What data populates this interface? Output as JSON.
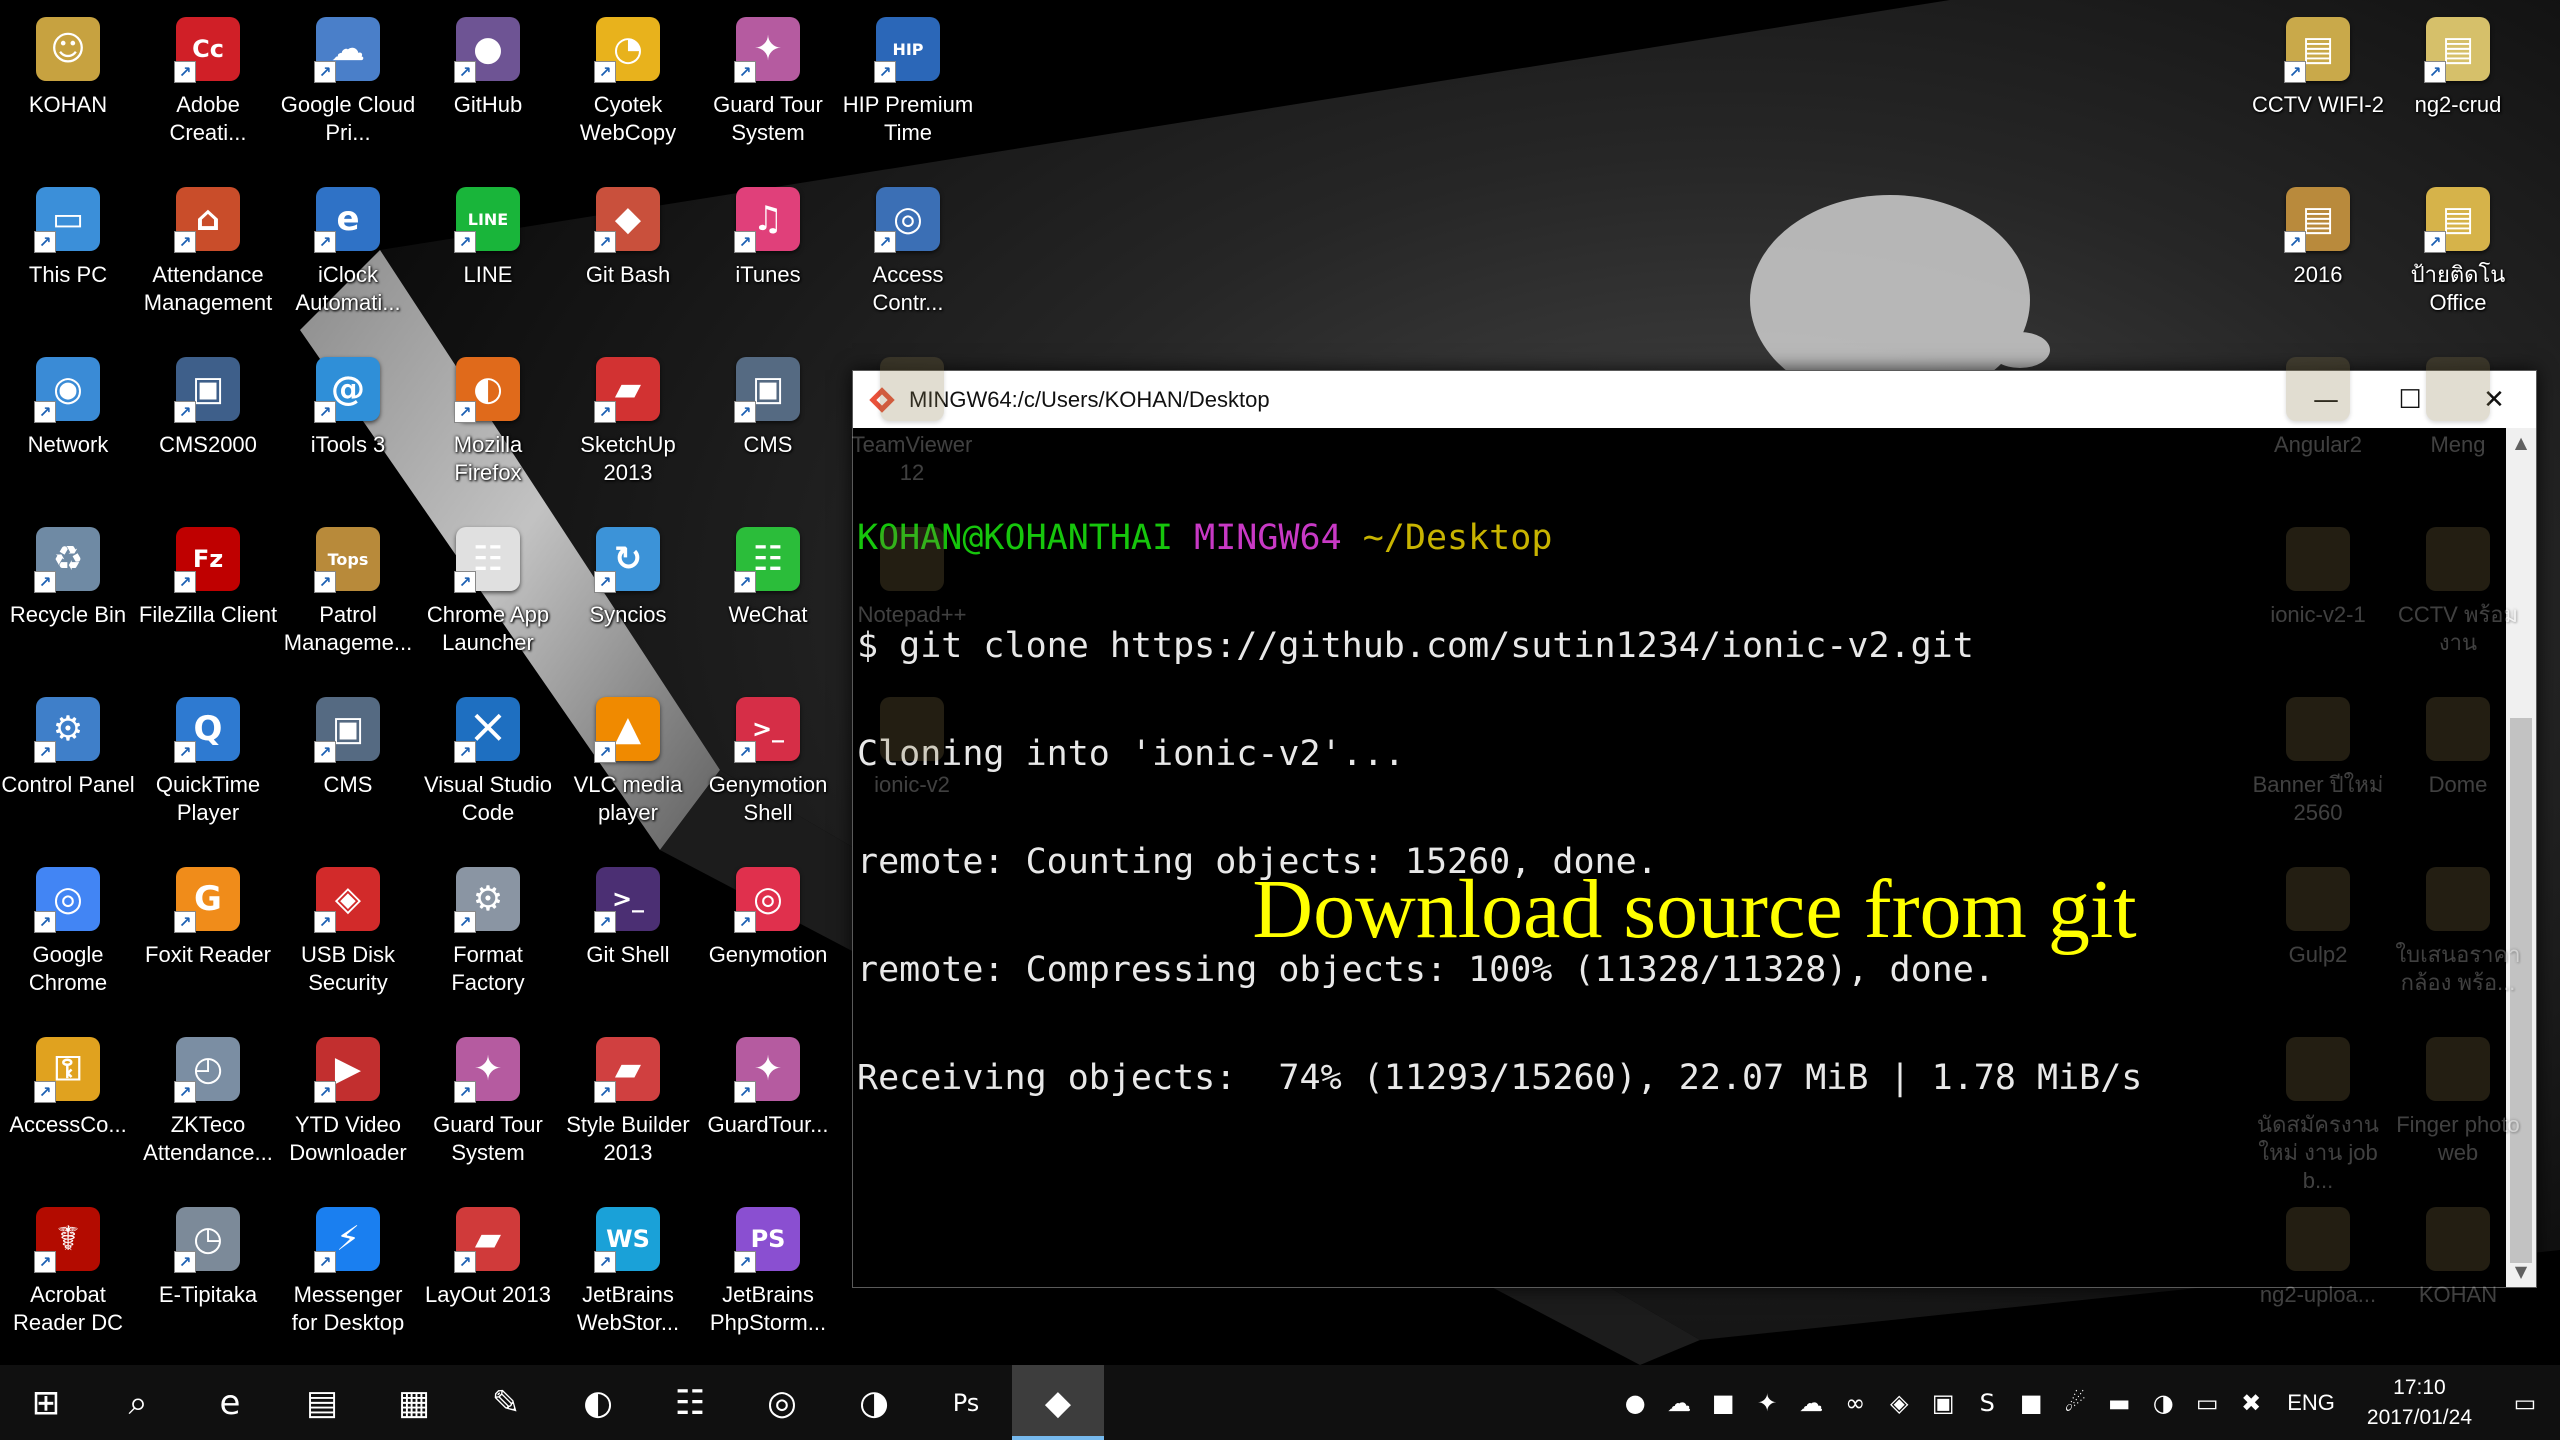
{
  "desktop": {
    "icons": [
      {
        "label": "KOHAN",
        "icon": "folder-user-icon",
        "color": "#c7a240",
        "glyph": "☺"
      },
      {
        "label": "Adobe Creati...",
        "icon": "adobe-cc-icon",
        "color": "#d01f27",
        "glyph": "Cc"
      },
      {
        "label": "Google Cloud Pri...",
        "icon": "printer-cloud-icon",
        "color": "#4a7fc9",
        "glyph": "☁"
      },
      {
        "label": "GitHub",
        "icon": "github-icon",
        "color": "#6e5494",
        "glyph": "●"
      },
      {
        "label": "Cyotek WebCopy",
        "icon": "webcopy-icon",
        "color": "#e8b21c",
        "glyph": "◔"
      },
      {
        "label": "Guard Tour System",
        "icon": "guard-tour-icon",
        "color": "#b55ba0",
        "glyph": "✦"
      },
      {
        "label": "HIP Premium Time",
        "icon": "hip-time-icon",
        "color": "#2b67b8",
        "glyph": "HIP"
      },
      {
        "label": "This PC",
        "icon": "computer-icon",
        "color": "#3b8fd9",
        "glyph": "▭"
      },
      {
        "label": "Attendance Management",
        "icon": "attendance-icon",
        "color": "#c94d2a",
        "glyph": "⌂"
      },
      {
        "label": "iClock Automati...",
        "icon": "iclock-icon",
        "color": "#2f72c6",
        "glyph": "e"
      },
      {
        "label": "LINE",
        "icon": "line-icon",
        "color": "#19b53a",
        "glyph": "LINE"
      },
      {
        "label": "Git Bash",
        "icon": "git-bash-icon",
        "color": "#c9503c",
        "glyph": "◆"
      },
      {
        "label": "iTunes",
        "icon": "itunes-icon",
        "color": "#e0407a",
        "glyph": "♫"
      },
      {
        "label": "Access Contr...",
        "icon": "access-control-icon",
        "color": "#3b6fb5",
        "glyph": "◎"
      },
      {
        "label": "Network",
        "icon": "network-icon",
        "color": "#3a8bd6",
        "glyph": "◉"
      },
      {
        "label": "CMS2000",
        "icon": "cms2000-icon",
        "color": "#3e5f8a",
        "glyph": "▣"
      },
      {
        "label": "iTools 3",
        "icon": "itools-icon",
        "color": "#2f8fd8",
        "glyph": "@"
      },
      {
        "label": "Mozilla Firefox",
        "icon": "firefox-icon",
        "color": "#e06a1b",
        "glyph": "◐"
      },
      {
        "label": "SketchUp 2013",
        "icon": "sketchup-icon",
        "color": "#d23232",
        "glyph": "▰"
      },
      {
        "label": "CMS",
        "icon": "cms-icon",
        "color": "#556a82",
        "glyph": "▣"
      },
      {
        "label": "Recycle Bin",
        "icon": "recycle-bin-icon",
        "color": "#6f8aa4",
        "glyph": "♻"
      },
      {
        "label": "FileZilla Client",
        "icon": "filezilla-icon",
        "color": "#bf0000",
        "glyph": "Fz"
      },
      {
        "label": "Patrol Manageme...",
        "icon": "patrol-icon",
        "color": "#b88a3a",
        "glyph": "Tops"
      },
      {
        "label": "Chrome App Launcher",
        "icon": "app-launcher-icon",
        "color": "#e0e0e0",
        "glyph": "☷"
      },
      {
        "label": "Syncios",
        "icon": "syncios-icon",
        "color": "#3c93d8",
        "glyph": "↻"
      },
      {
        "label": "WeChat",
        "icon": "wechat-icon",
        "color": "#2bbd3a",
        "glyph": "☷"
      },
      {
        "label": "Control Panel",
        "icon": "control-panel-icon",
        "color": "#3f7fc9",
        "glyph": "⚙"
      },
      {
        "label": "QuickTime Player",
        "icon": "quicktime-icon",
        "color": "#2e7ad1",
        "glyph": "Q"
      },
      {
        "label": "CMS",
        "icon": "cms-icon",
        "color": "#556a82",
        "glyph": "▣"
      },
      {
        "label": "Visual Studio Code",
        "icon": "vscode-icon",
        "color": "#1e6fc1",
        "glyph": "⨉"
      },
      {
        "label": "VLC media player",
        "icon": "vlc-icon",
        "color": "#f08a00",
        "glyph": "▲"
      },
      {
        "label": "Genymotion Shell",
        "icon": "genymotion-shell-icon",
        "color": "#d62e47",
        "glyph": ">_"
      },
      {
        "label": "Google Chrome",
        "icon": "chrome-icon",
        "color": "#4285f4",
        "glyph": "◎"
      },
      {
        "label": "Foxit Reader",
        "icon": "foxit-icon",
        "color": "#f08c1a",
        "glyph": "G"
      },
      {
        "label": "USB Disk Security",
        "icon": "usb-security-icon",
        "color": "#d22a2a",
        "glyph": "◈"
      },
      {
        "label": "Format Factory",
        "icon": "format-factory-icon",
        "color": "#8a95a3",
        "glyph": "⚙"
      },
      {
        "label": "Git Shell",
        "icon": "git-shell-icon",
        "color": "#4b2f73",
        "glyph": ">_"
      },
      {
        "label": "Genymotion",
        "icon": "genymotion-icon",
        "color": "#e0304d",
        "glyph": "◎"
      },
      {
        "label": "AccessCo...",
        "icon": "access-key-icon",
        "color": "#e0a21f",
        "glyph": "⚿"
      },
      {
        "label": "ZKTeco Attendance...",
        "icon": "zkteco-icon",
        "color": "#7b8ea3",
        "glyph": "◴"
      },
      {
        "label": "YTD Video Downloader",
        "icon": "ytd-icon",
        "color": "#c22f2f",
        "glyph": "▶"
      },
      {
        "label": "Guard Tour System",
        "icon": "guard-tour-icon",
        "color": "#b55ba0",
        "glyph": "✦"
      },
      {
        "label": "Style Builder 2013",
        "icon": "style-builder-icon",
        "color": "#d04040",
        "glyph": "▰"
      },
      {
        "label": "GuardTour...",
        "icon": "guard-tour-icon",
        "color": "#b55ba0",
        "glyph": "✦"
      },
      {
        "label": "Acrobat Reader DC",
        "icon": "acrobat-icon",
        "color": "#b30b00",
        "glyph": "☤"
      },
      {
        "label": "E-Tipitaka",
        "icon": "etipitaka-icon",
        "color": "#7c8a99",
        "glyph": "◷"
      },
      {
        "label": "Messenger for Desktop",
        "icon": "messenger-icon",
        "color": "#1a7ff0",
        "glyph": "⚡"
      },
      {
        "label": "LayOut 2013",
        "icon": "layout-icon",
        "color": "#d03a3a",
        "glyph": "▰"
      },
      {
        "label": "JetBrains WebStor...",
        "icon": "webstorm-icon",
        "color": "#1aa1d8",
        "glyph": "WS"
      },
      {
        "label": "JetBrains PhpStorm...",
        "icon": "phpstorm-icon",
        "color": "#8a4fd1",
        "glyph": "PS"
      },
      {
        "label": "CCTV WIFI-2",
        "icon": "file-icon",
        "color": "#c9a94a",
        "glyph": "▤"
      },
      {
        "label": "ng2-crud",
        "icon": "file-icon",
        "color": "#d6c06a",
        "glyph": "▤"
      },
      {
        "label": "2016",
        "icon": "file-icon",
        "color": "#b98a3c",
        "glyph": "▤"
      },
      {
        "label": "ป้ายติดโน Office",
        "icon": "file-icon",
        "color": "#d6b34a",
        "glyph": "▤"
      }
    ],
    "hidden_icons": [
      {
        "label": "TeamViewer 12",
        "icon": "teamviewer-icon"
      },
      {
        "label": "Notepad++",
        "icon": "notepadpp-icon"
      },
      {
        "label": "ionic-v2",
        "icon": "folder-icon"
      },
      {
        "label": "Angular2",
        "icon": "folder-icon"
      },
      {
        "label": "Meng",
        "icon": "folder-icon"
      },
      {
        "label": "ionic-v2-1",
        "icon": "file-icon"
      },
      {
        "label": "CCTV พร้อมงาน",
        "icon": "file-icon"
      },
      {
        "label": "Banner ปีใหม่ 2560",
        "icon": "folder-icon"
      },
      {
        "label": "Dome",
        "icon": "folder-icon"
      },
      {
        "label": "Gulp2",
        "icon": "folder-icon"
      },
      {
        "label": "ใบเสนอราคา กล้อง พร้อ...",
        "icon": "file-icon"
      },
      {
        "label": "นัดสมัครงานใหม่ งาน job b...",
        "icon": "excel-icon"
      },
      {
        "label": "Finger photo web",
        "icon": "file-icon"
      },
      {
        "label": "ng2-uploa...",
        "icon": "file-icon"
      },
      {
        "label": "KOHAN",
        "icon": "file-icon"
      }
    ]
  },
  "terminal": {
    "title": "MINGW64:/c/Users/KOHAN/Desktop",
    "prompt_user": "KOHAN@KOHANTHAI",
    "prompt_env": "MINGW64",
    "prompt_path": "~/Desktop",
    "lines": [
      "$ git clone https://github.com/sutin1234/ionic-v2.git",
      "Cloning into 'ionic-v2'...",
      "remote: Counting objects: 15260, done.",
      "remote: Compressing objects: 100% (11328/11328), done.",
      "Receiving objects:  74% (11293/15260), 22.07 MiB | 1.78 MiB/s"
    ],
    "buttons": {
      "minimize": "—",
      "maximize": "☐",
      "close": "✕"
    }
  },
  "caption": "Download source from git",
  "taskbar": {
    "apps": [
      {
        "name": "start-button",
        "glyph": "⊞",
        "active": false
      },
      {
        "name": "search-icon",
        "glyph": "⌕",
        "active": false
      },
      {
        "name": "edge-taskbar-icon",
        "glyph": "e",
        "active": false
      },
      {
        "name": "file-explorer-taskbar-icon",
        "glyph": "▤",
        "active": false
      },
      {
        "name": "store-taskbar-icon",
        "glyph": "▦",
        "active": false
      },
      {
        "name": "paint-taskbar-icon",
        "glyph": "✎",
        "active": false
      },
      {
        "name": "itools-taskbar-icon",
        "glyph": "◐",
        "active": false
      },
      {
        "name": "app-launcher-taskbar-icon",
        "glyph": "☷",
        "active": false
      },
      {
        "name": "chrome-taskbar-icon",
        "glyph": "◎",
        "active": false
      },
      {
        "name": "firefox-taskbar-icon",
        "glyph": "◑",
        "active": false
      },
      {
        "name": "photoshop-taskbar-icon",
        "glyph": "Ps",
        "active": false
      },
      {
        "name": "git-bash-taskbar-icon",
        "glyph": "◆",
        "active": true
      }
    ],
    "tray": [
      {
        "name": "messenger-tray-icon",
        "glyph": "●"
      },
      {
        "name": "cloud-tray-icon",
        "glyph": "☁"
      },
      {
        "name": "line-tray-icon",
        "glyph": "■"
      },
      {
        "name": "guard-tray-icon",
        "glyph": "✦"
      },
      {
        "name": "onedrive-tray-icon",
        "glyph": "☁"
      },
      {
        "name": "link-tray-icon",
        "glyph": "∞"
      },
      {
        "name": "shield-tray-icon",
        "glyph": "◈"
      },
      {
        "name": "app-tray-icon",
        "glyph": "▣"
      },
      {
        "name": "skype-tray-icon",
        "glyph": "S"
      },
      {
        "name": "nvidia-tray-icon",
        "glyph": "■"
      },
      {
        "name": "satellite-tray-icon",
        "glyph": "☄"
      },
      {
        "name": "chat-tray-icon",
        "glyph": "▬"
      },
      {
        "name": "sync-tray-icon",
        "glyph": "◑"
      },
      {
        "name": "network-tray-icon",
        "glyph": "▭"
      },
      {
        "name": "volume-muted-tray-icon",
        "glyph": "✖"
      }
    ],
    "language": "ENG",
    "time": "17:10",
    "date": "2017/01/24",
    "notification_glyph": "▭"
  }
}
